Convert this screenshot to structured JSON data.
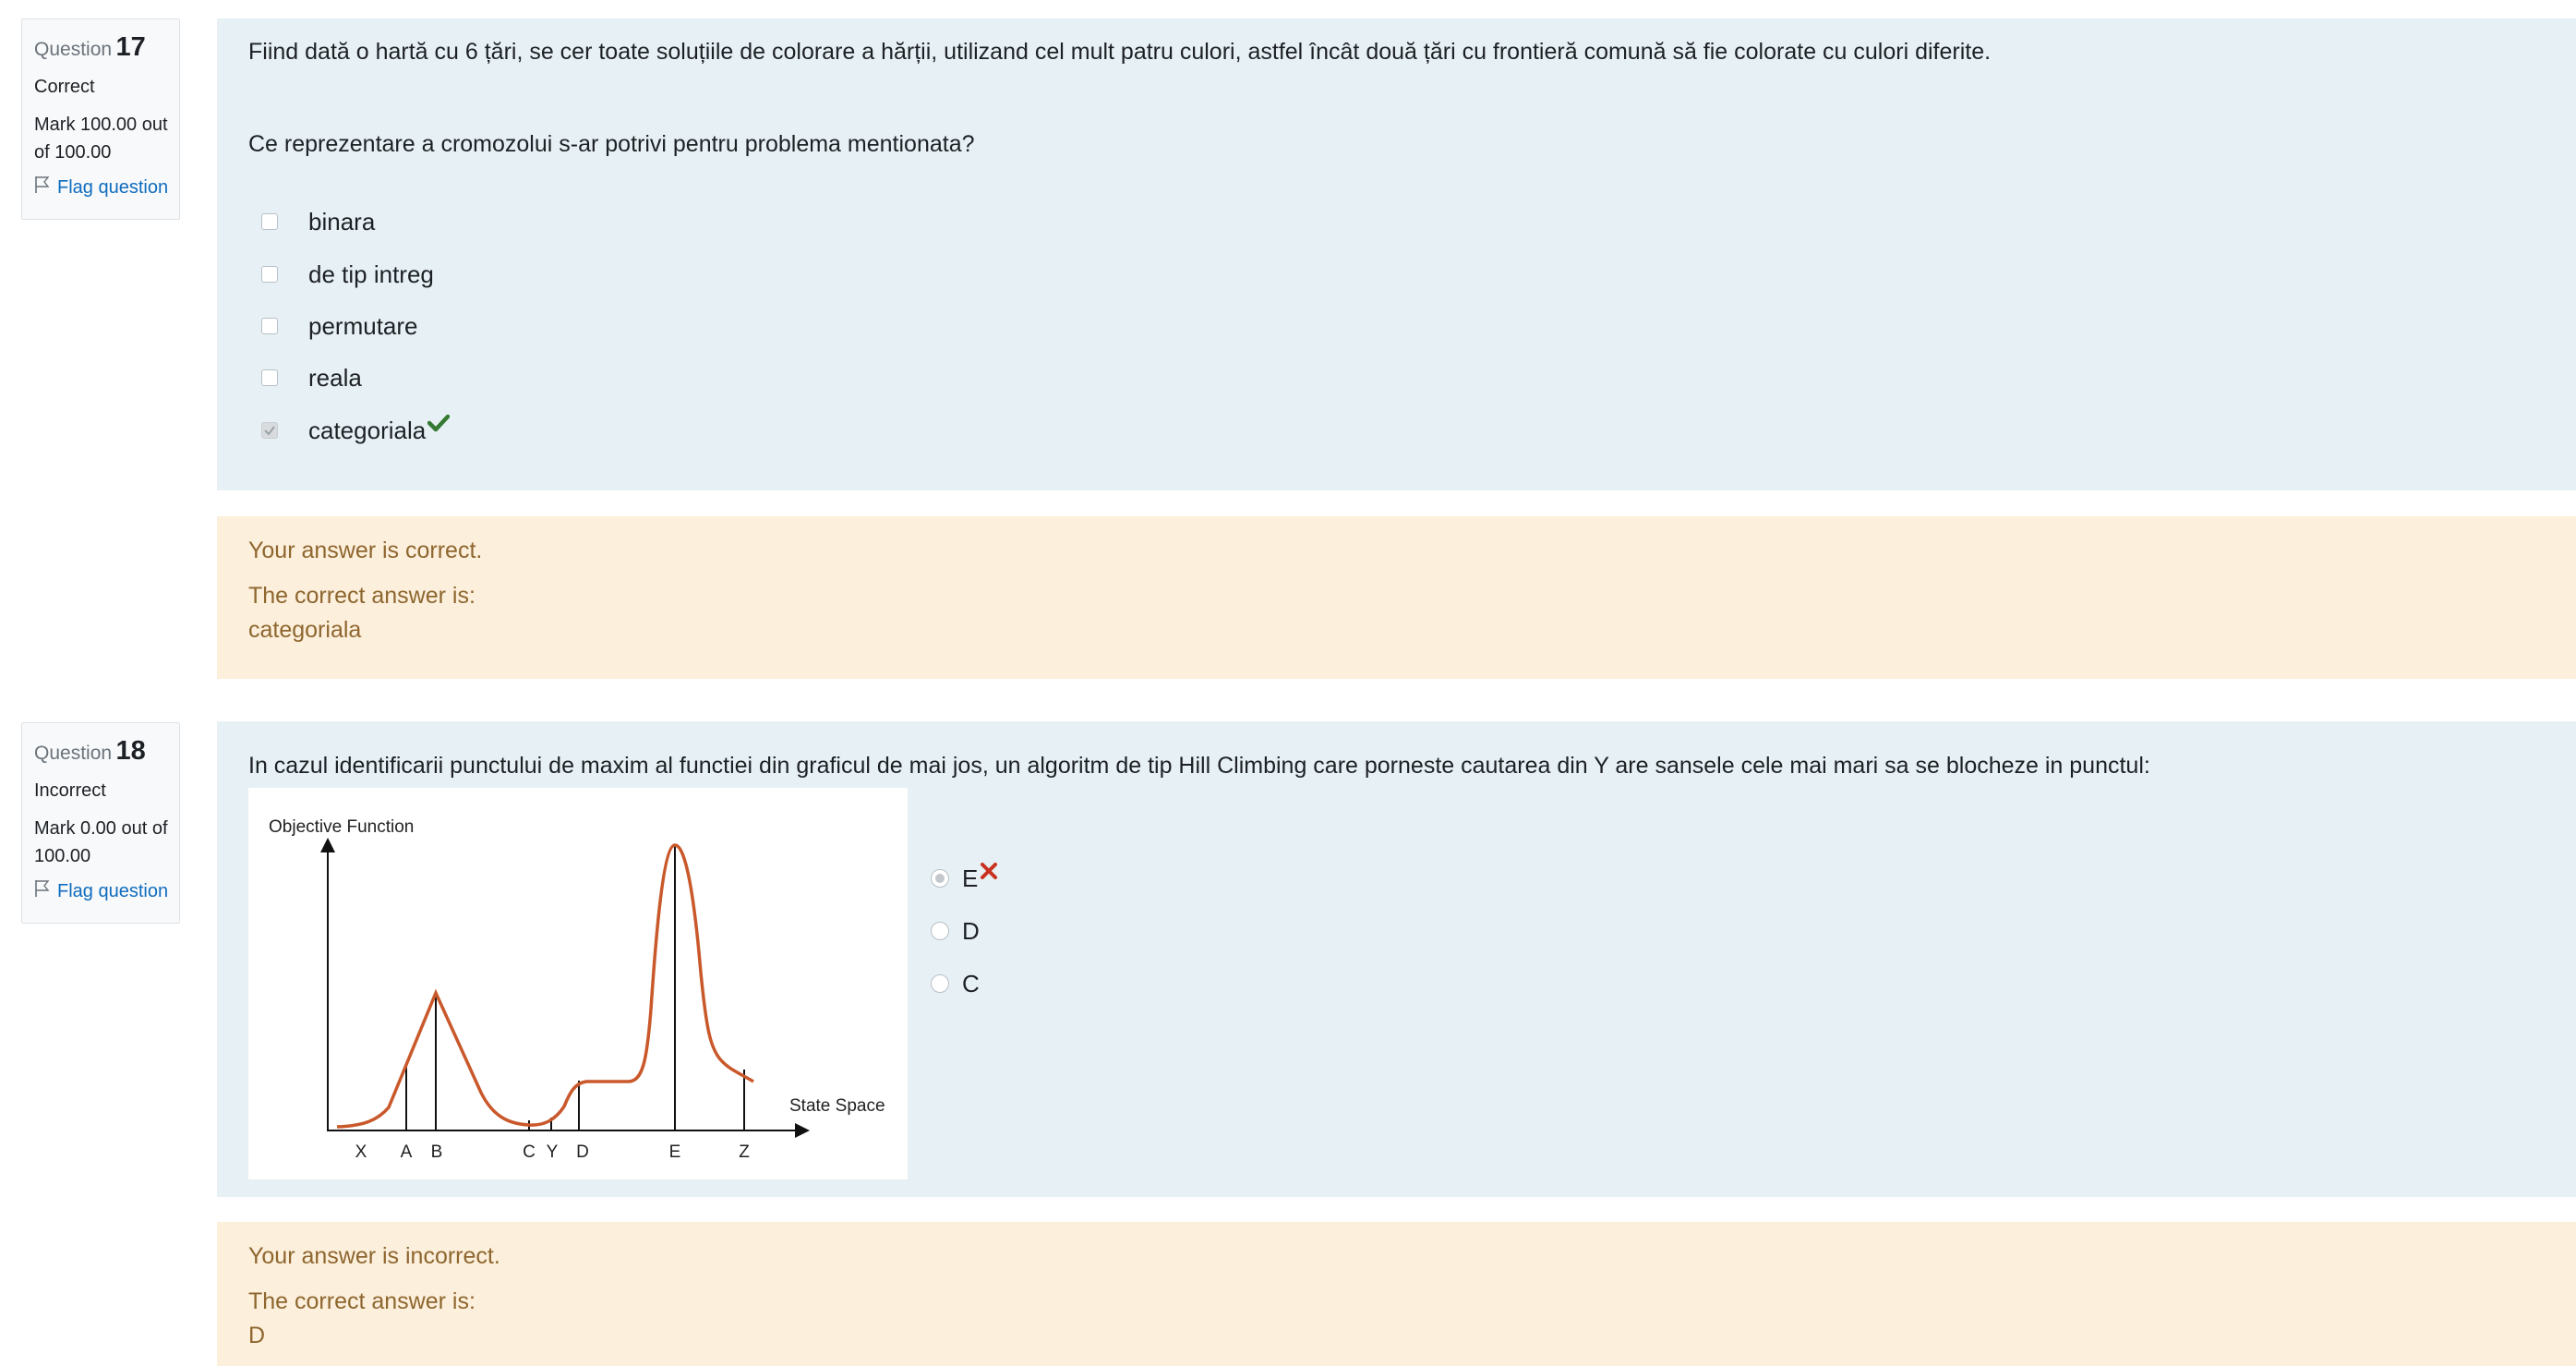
{
  "q17": {
    "info": {
      "label": "Question",
      "number": "17",
      "state": "Correct",
      "grade": "Mark 100.00 out of 100.00",
      "flag_label": "Flag question"
    },
    "text": "Fiind dată o hartă cu 6 țări, se cer toate soluțiile de colorare a hărții, utilizand cel mult patru culori, astfel încât două țări cu frontieră comună să fie colorate cu culori diferite.",
    "prompt": "Ce reprezentare a cromozolui s-ar potrivi pentru problema mentionata?",
    "options": [
      {
        "label": "binara",
        "checked": false
      },
      {
        "label": "de tip intreg",
        "checked": false
      },
      {
        "label": "permutare",
        "checked": false
      },
      {
        "label": "reala",
        "checked": false
      },
      {
        "label": "categoriala",
        "checked": true,
        "mark": "check-icon"
      }
    ],
    "feedback": {
      "status": "Your answer is correct.",
      "correct_label": "The correct answer is:",
      "correct_value": "categoriala"
    }
  },
  "q18": {
    "info": {
      "label": "Question",
      "number": "18",
      "state": "Incorrect",
      "grade": "Mark 0.00 out of 100.00",
      "flag_label": "Flag question"
    },
    "text": "In cazul identificarii punctului de maxim al functiei din graficul de mai jos, un algoritm de tip Hill Climbing care porneste cautarea din Y are sansele cele mai mari sa se blocheze in punctul:",
    "graph": {
      "y_label": "Objective Function",
      "x_label": "State Space",
      "points": [
        "X",
        "A",
        "B",
        "C",
        "Y",
        "D",
        "E",
        "Z"
      ]
    },
    "options": [
      {
        "label": "E",
        "checked": true,
        "mark": "cross-icon"
      },
      {
        "label": "D",
        "checked": false
      },
      {
        "label": "C",
        "checked": false
      }
    ],
    "feedback": {
      "status": "Your answer is incorrect.",
      "correct_label": "The correct answer is:",
      "correct_value": "D"
    }
  },
  "colors": {
    "formulation_bg": "#e7f1f5",
    "feedback_bg": "#fcefdc",
    "feedback_text": "#8e662e",
    "link": "#0f6cbf",
    "correct_icon": "#357a32",
    "incorrect_icon": "#ca3120",
    "curve": "#c9582b"
  }
}
